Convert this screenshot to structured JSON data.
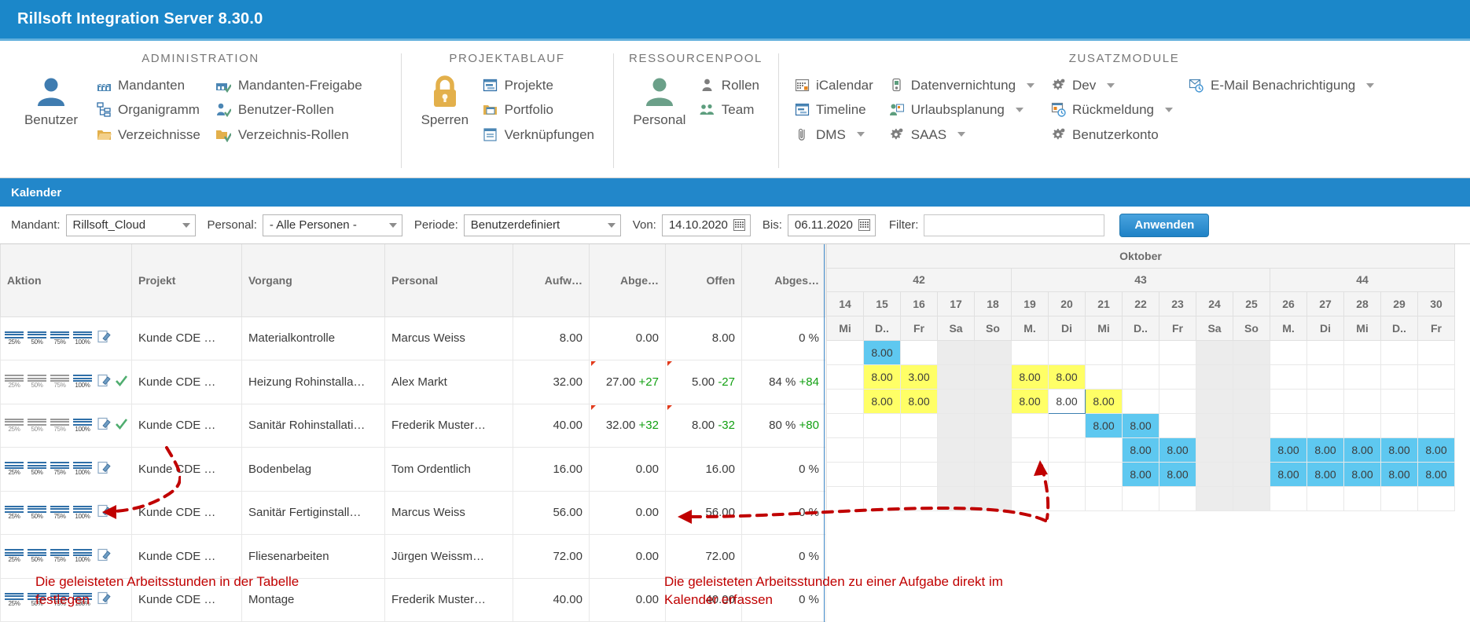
{
  "window": {
    "title": "Rillsoft Integration Server 8.30.0"
  },
  "ribbon": {
    "groups": [
      {
        "title": "ADMINISTRATION",
        "big": {
          "label": "Benutzer",
          "icon": "user-icon"
        },
        "columns": [
          [
            {
              "label": "Mandanten",
              "icon": "factory-icon",
              "caret": false
            },
            {
              "label": "Organigramm",
              "icon": "orgchart-icon",
              "caret": false
            },
            {
              "label": "Verzeichnisse",
              "icon": "folder-icon",
              "caret": false
            }
          ],
          [
            {
              "label": "Mandanten-Freigabe",
              "icon": "factory-check-icon",
              "caret": false
            },
            {
              "label": "Benutzer-Rollen",
              "icon": "user-check-icon",
              "caret": false
            },
            {
              "label": "Verzeichnis-Rollen",
              "icon": "folder-check-icon",
              "caret": false
            }
          ]
        ]
      },
      {
        "title": "PROJEKTABLAUF",
        "big": {
          "label": "Sperren",
          "icon": "lock-icon"
        },
        "columns": [
          [
            {
              "label": "Projekte",
              "icon": "project-icon",
              "caret": false
            },
            {
              "label": "Portfolio",
              "icon": "portfolio-icon",
              "caret": false
            },
            {
              "label": "Verknüpfungen",
              "icon": "link-icon",
              "caret": false
            }
          ]
        ]
      },
      {
        "title": "RESSOURCENPOOL",
        "big": {
          "label": "Personal",
          "icon": "person-icon"
        },
        "columns": [
          [
            {
              "label": "Rollen",
              "icon": "role-icon",
              "caret": false
            },
            {
              "label": "Team",
              "icon": "team-icon",
              "caret": false
            }
          ]
        ]
      },
      {
        "title": "ZUSATZMODULE",
        "big": null,
        "columns": [
          [
            {
              "label": "iCalendar",
              "icon": "calendar-icon",
              "caret": false
            },
            {
              "label": "Timeline",
              "icon": "timeline-icon",
              "caret": false
            },
            {
              "label": "DMS",
              "icon": "dms-icon",
              "caret": true
            }
          ],
          [
            {
              "label": "Datenvernichtung",
              "icon": "shredder-icon",
              "caret": true
            },
            {
              "label": "Urlaubsplanung",
              "icon": "vacation-icon",
              "caret": true
            },
            {
              "label": "SAAS",
              "icon": "gears-icon",
              "caret": true
            }
          ],
          [
            {
              "label": "Dev",
              "icon": "gears-icon",
              "caret": true
            },
            {
              "label": "Rückmeldung",
              "icon": "feedback-icon",
              "caret": true
            },
            {
              "label": "Benutzerkonto",
              "icon": "gears-icon",
              "caret": false
            }
          ],
          [
            {
              "label": "E-Mail Benachrichtigung",
              "icon": "mail-clock-icon",
              "caret": true
            }
          ]
        ]
      }
    ]
  },
  "section": {
    "title": "Kalender"
  },
  "filters": {
    "mandant_label": "Mandant:",
    "mandant_value": "Rillsoft_Cloud",
    "personal_label": "Personal:",
    "personal_value": "- Alle Personen -",
    "periode_label": "Periode:",
    "periode_value": "Benutzerdefiniert",
    "von_label": "Von:",
    "von_value": "14.10.2020",
    "bis_label": "Bis:",
    "bis_value": "06.11.2020",
    "filter_label": "Filter:",
    "filter_value": "",
    "filter_placeholder": "",
    "apply_label": "Anwenden"
  },
  "grid": {
    "columns": [
      "Aktion",
      "Projekt",
      "Vorgang",
      "Personal",
      "Aufw…",
      "Abge…",
      "Offen",
      "Abges…"
    ],
    "rows": [
      {
        "projekt": "Kunde CDE …",
        "vorgang": "Materialkontrolle",
        "personal": "Marcus Weiss",
        "aufwand": "8.00",
        "abgeleistet": "0.00",
        "abgeleistet_delta": "",
        "offen": "8.00",
        "offen_delta": "",
        "abgeschlossen": "0 %",
        "abgeschlossen_delta": "",
        "checked": false,
        "active_pct": true,
        "marker": false
      },
      {
        "projekt": "Kunde CDE …",
        "vorgang": "Heizung Rohinstalla…",
        "personal": "Alex Markt",
        "aufwand": "32.00",
        "abgeleistet": "27.00",
        "abgeleistet_delta": "+27",
        "offen": "5.00",
        "offen_delta": "-27",
        "abgeschlossen": "84 %",
        "abgeschlossen_delta": "+84",
        "checked": true,
        "active_pct": false,
        "marker": true
      },
      {
        "projekt": "Kunde CDE …",
        "vorgang": "Sanitär Rohinstallati…",
        "personal": "Frederik Muster…",
        "aufwand": "40.00",
        "abgeleistet": "32.00",
        "abgeleistet_delta": "+32",
        "offen": "8.00",
        "offen_delta": "-32",
        "abgeschlossen": "80 %",
        "abgeschlossen_delta": "+80",
        "checked": true,
        "active_pct": false,
        "marker": true
      },
      {
        "projekt": "Kunde CDE …",
        "vorgang": "Bodenbelag",
        "personal": "Tom Ordentlich",
        "aufwand": "16.00",
        "abgeleistet": "0.00",
        "abgeleistet_delta": "",
        "offen": "16.00",
        "offen_delta": "",
        "abgeschlossen": "0 %",
        "abgeschlossen_delta": "",
        "checked": false,
        "active_pct": true,
        "marker": false
      },
      {
        "projekt": "Kunde CDE …",
        "vorgang": "Sanitär Fertiginstall…",
        "personal": "Marcus Weiss",
        "aufwand": "56.00",
        "abgeleistet": "0.00",
        "abgeleistet_delta": "",
        "offen": "56.00",
        "offen_delta": "",
        "abgeschlossen": "0 %",
        "abgeschlossen_delta": "",
        "checked": false,
        "active_pct": true,
        "marker": false
      },
      {
        "projekt": "Kunde CDE …",
        "vorgang": "Fliesenarbeiten",
        "personal": "Jürgen Weissm…",
        "aufwand": "72.00",
        "abgeleistet": "0.00",
        "abgeleistet_delta": "",
        "offen": "72.00",
        "offen_delta": "",
        "abgeschlossen": "0 %",
        "abgeschlossen_delta": "",
        "checked": false,
        "active_pct": true,
        "marker": false
      },
      {
        "projekt": "Kunde CDE …",
        "vorgang": "Montage",
        "personal": "Frederik Muster…",
        "aufwand": "40.00",
        "abgeleistet": "0.00",
        "abgeleistet_delta": "",
        "offen": "40.00",
        "offen_delta": "",
        "abgeschlossen": "0 %",
        "abgeschlossen_delta": "",
        "checked": false,
        "active_pct": true,
        "marker": false
      }
    ],
    "pct_labels": [
      "25%",
      "50%",
      "75%",
      "100%"
    ]
  },
  "calendar": {
    "months": [
      {
        "label": "Oktober",
        "span": 17
      }
    ],
    "weeks": [
      {
        "label": "42",
        "span": 5
      },
      {
        "label": "43",
        "span": 7
      },
      {
        "label": "44",
        "span": 5
      }
    ],
    "days": [
      {
        "num": "14",
        "dow": "Mi",
        "weekend": false
      },
      {
        "num": "15",
        "dow": "D..",
        "weekend": false
      },
      {
        "num": "16",
        "dow": "Fr",
        "weekend": false
      },
      {
        "num": "17",
        "dow": "Sa",
        "weekend": true
      },
      {
        "num": "18",
        "dow": "So",
        "weekend": true
      },
      {
        "num": "19",
        "dow": "M.",
        "weekend": false
      },
      {
        "num": "20",
        "dow": "Di",
        "weekend": false
      },
      {
        "num": "21",
        "dow": "Mi",
        "weekend": false
      },
      {
        "num": "22",
        "dow": "D..",
        "weekend": false
      },
      {
        "num": "23",
        "dow": "Fr",
        "weekend": false
      },
      {
        "num": "24",
        "dow": "Sa",
        "weekend": true
      },
      {
        "num": "25",
        "dow": "So",
        "weekend": true
      },
      {
        "num": "26",
        "dow": "M.",
        "weekend": false
      },
      {
        "num": "27",
        "dow": "Di",
        "weekend": false
      },
      {
        "num": "28",
        "dow": "Mi",
        "weekend": false
      },
      {
        "num": "29",
        "dow": "D..",
        "weekend": false
      },
      {
        "num": "30",
        "dow": "Fr",
        "weekend": false
      }
    ],
    "cells": [
      [
        null,
        "8.00",
        null,
        null,
        null,
        null,
        null,
        null,
        null,
        null,
        null,
        null,
        null,
        null,
        null,
        null,
        null
      ],
      [
        null,
        "8.00",
        "3.00",
        null,
        null,
        "8.00",
        "8.00",
        null,
        null,
        null,
        null,
        null,
        null,
        null,
        null,
        null,
        null
      ],
      [
        null,
        "8.00",
        "8.00",
        null,
        null,
        "8.00",
        "8.00",
        "8.00",
        null,
        null,
        null,
        null,
        null,
        null,
        null,
        null,
        null
      ],
      [
        null,
        null,
        null,
        null,
        null,
        null,
        null,
        "8.00",
        "8.00",
        null,
        null,
        null,
        null,
        null,
        null,
        null,
        null
      ],
      [
        null,
        null,
        null,
        null,
        null,
        null,
        null,
        null,
        "8.00",
        "8.00",
        null,
        null,
        "8.00",
        "8.00",
        "8.00",
        "8.00",
        "8.00"
      ],
      [
        null,
        null,
        null,
        null,
        null,
        null,
        null,
        null,
        "8.00",
        "8.00",
        null,
        null,
        "8.00",
        "8.00",
        "8.00",
        "8.00",
        "8.00"
      ],
      [
        null,
        null,
        null,
        null,
        null,
        null,
        null,
        null,
        null,
        null,
        null,
        null,
        null,
        null,
        null,
        null,
        null
      ]
    ],
    "styles": [
      [
        "",
        "b",
        "",
        "",
        "",
        "",
        "",
        "",
        "",
        "",
        "",
        "",
        "",
        "",
        "",
        "",
        ""
      ],
      [
        "",
        "y",
        "y",
        "",
        "",
        "y",
        "y",
        "",
        "",
        "",
        "",
        "",
        "",
        "",
        "",
        "",
        ""
      ],
      [
        "",
        "y",
        "y",
        "",
        "",
        "y",
        "e",
        "y",
        "",
        "",
        "",
        "",
        "",
        "",
        "",
        "",
        ""
      ],
      [
        "",
        "",
        "",
        "",
        "",
        "",
        "",
        "b",
        "b",
        "",
        "",
        "",
        "",
        "",
        "",
        "",
        ""
      ],
      [
        "",
        "",
        "",
        "",
        "",
        "",
        "",
        "",
        "b",
        "b",
        "",
        "",
        "b",
        "b",
        "b",
        "b",
        "b"
      ],
      [
        "",
        "",
        "",
        "",
        "",
        "",
        "",
        "",
        "b",
        "b",
        "",
        "",
        "b",
        "b",
        "b",
        "b",
        "b"
      ],
      [
        "",
        "",
        "",
        "",
        "",
        "",
        "",
        "",
        "",
        "",
        "",
        "",
        "",
        "",
        "",
        "",
        ""
      ]
    ]
  },
  "annotations": [
    {
      "id": "annot-table",
      "text": "Die geleisteten Arbeitsstunden in der Tabelle\nfestlegen"
    },
    {
      "id": "annot-calendar",
      "text": "Die geleisteten Arbeitsstunden zu einer Aufgabe direkt im\nKalender erfassen"
    }
  ],
  "colors": {
    "accent": "#1b87c9",
    "highlight_yellow": "#ffff66",
    "highlight_blue": "#5ec8f0",
    "annotation_red": "#c00000",
    "positive_green": "#12a012",
    "weekend_red": "#e8100f"
  }
}
